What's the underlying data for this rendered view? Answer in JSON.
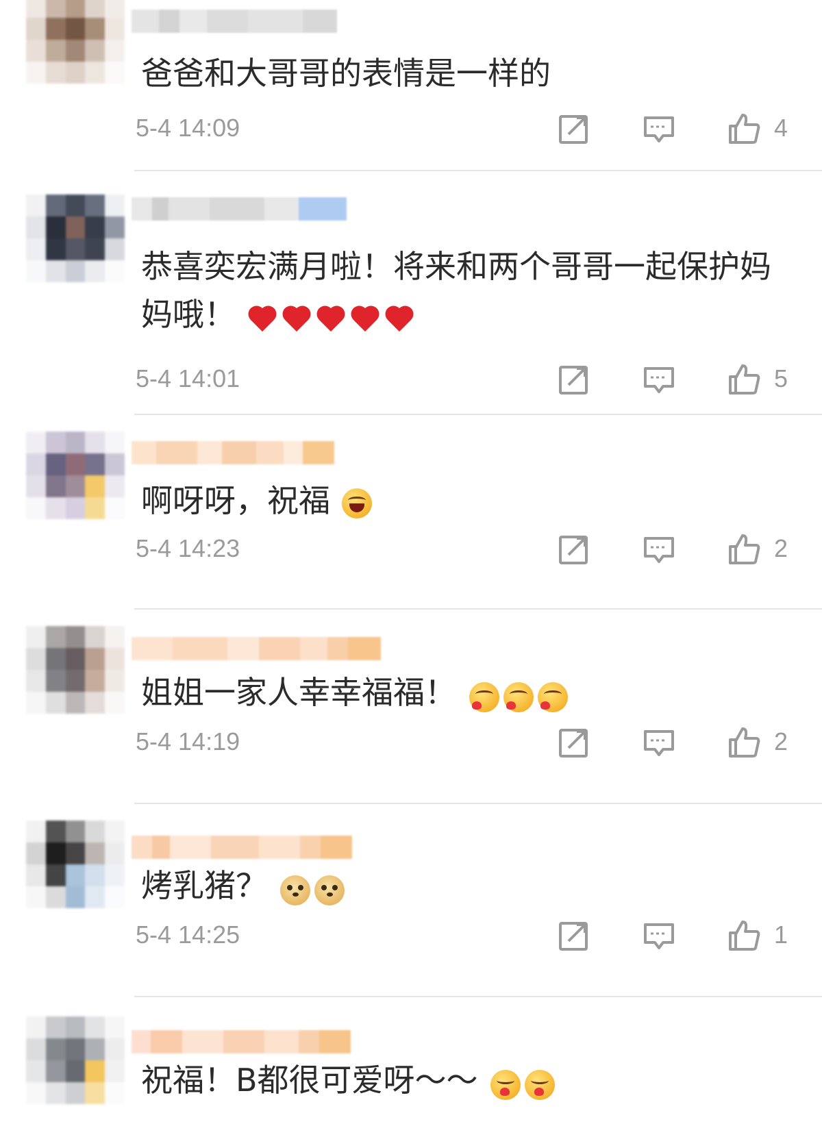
{
  "colors": {
    "text": "#2b2b2b",
    "meta": "#9a9a9a",
    "divider": "#e6e6e6",
    "icon": "#9a9a9a"
  },
  "icons": {
    "share": "share-icon",
    "reply": "comment-icon",
    "like": "thumbs-up-icon"
  },
  "comments": [
    {
      "text": "爸爸和大哥哥的表情是一样的",
      "time": "5-4 14:09",
      "likes": "4"
    },
    {
      "text": "恭喜奕宏满月啦！将来和两个哥哥一起保护妈妈哦！",
      "time": "5-4 14:01",
      "likes": "5"
    },
    {
      "text": "啊呀呀，祝福",
      "time": "5-4 14:23",
      "likes": "2"
    },
    {
      "text": "姐姐一家人幸幸福福！",
      "time": "5-4 14:19",
      "likes": "2"
    },
    {
      "text": "烤乳猪？",
      "time": "5-4 14:25",
      "likes": "1"
    },
    {
      "text": "祝福！B都很可爱呀～～",
      "time": "",
      "likes": ""
    }
  ]
}
